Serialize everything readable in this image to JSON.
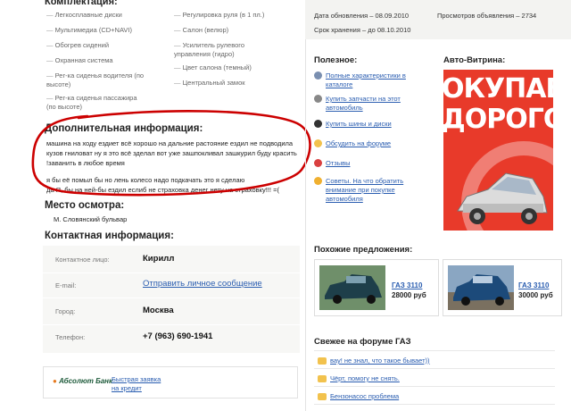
{
  "equipment": {
    "title": "Комплектация:",
    "left": [
      "Легкосплавные диски",
      "Мультимедиа (CD+NAVI)",
      "Обогрев сидений",
      "Охранная система",
      "Рег-ка сиденья водителя (по высоте)",
      "Рег-ка сиденья пассажира (по высоте)"
    ],
    "right": [
      "Регулировка руля (в 1 пл.)",
      "Салон (велюр)",
      "Усилитель рулевого управления (гидро)",
      "Цвет салона (темный)",
      "Центральный замок"
    ]
  },
  "meta": {
    "updated": "Дата обновления – 08.09.2010",
    "views": "Просмотров объявления – 2734",
    "expires": "Срок хранения – до 08.10.2010"
  },
  "extra": {
    "title": "Дополнительная информация:",
    "line1": "машина на ходу ездиет всё хорошо на дальние растояние ездил не подводила",
    "line2": "кузов гниловат ну я это всё зделал вот уже зашпокливал зашкурил буду красить",
    "line3": "!заванить в любое время",
    "line4": "я бы её помыл бы но лень колесо надо подкачать это я сделаю",
    "line5": "да Я, бы на ней-бы ездил еслиб не страховка денег нету на страховку!!! =("
  },
  "inspection": {
    "title": "Место осмотра:",
    "place": "М. Словянский бульвар"
  },
  "contact": {
    "title": "Контактная информация:",
    "name_label": "Контактное лицо:",
    "name": "Кирилл",
    "email_label": "E-mail:",
    "email_link": "Отправить личное сообщение",
    "city_label": "Город:",
    "city": "Москва",
    "phone_label": "Телефон:",
    "phone": "+7 (963) 690-1941"
  },
  "bank": {
    "logo": "Абсолют Банк",
    "link_line1": "Быстрая заявка",
    "link_line2": "на кредит"
  },
  "useful": {
    "title": "Полезное:",
    "items": [
      {
        "line1": "Полные характеристики в",
        "line2": "каталоге",
        "icon": "car-icon",
        "color": "#7a8fb0"
      },
      {
        "line1": "Купить запчасти на этот",
        "line2": "автомобиль",
        "icon": "gear-icon",
        "color": "#888888"
      },
      {
        "line1": "Купить шины и диски",
        "line2": "",
        "icon": "tire-icon",
        "color": "#333333"
      },
      {
        "line1": "Обсудить на форуме",
        "line2": "",
        "icon": "chat-icon",
        "color": "#f2c24d"
      },
      {
        "line1": "Отзывы",
        "line2": "",
        "icon": "review-icon",
        "color": "#d94040"
      },
      {
        "line1": "Советы. На что обратить",
        "line2": "внимание при покупке",
        "line3": "автомобиля",
        "icon": "bulb-icon",
        "color": "#f0b030"
      }
    ]
  },
  "showcase": {
    "title": "Авто-Витрина:",
    "ad_line1": "ОКУПАЕ",
    "ad_line2": "ДОРОГО",
    "brand_color": "#e83a2a"
  },
  "similar": {
    "title": "Похожие предложения:",
    "items": [
      {
        "model": "ГАЗ 3110",
        "price": "28000 руб"
      },
      {
        "model": "ГАЗ 3110",
        "price": "30000 руб"
      }
    ]
  },
  "forum": {
    "title": "Свежее на форуме ГАЗ",
    "items": [
      "вау! не знал, что такое бывает))",
      "Чёрт, помогу не снять.",
      "Бензонасос проблема"
    ]
  },
  "annotation_color": "#cc0000"
}
